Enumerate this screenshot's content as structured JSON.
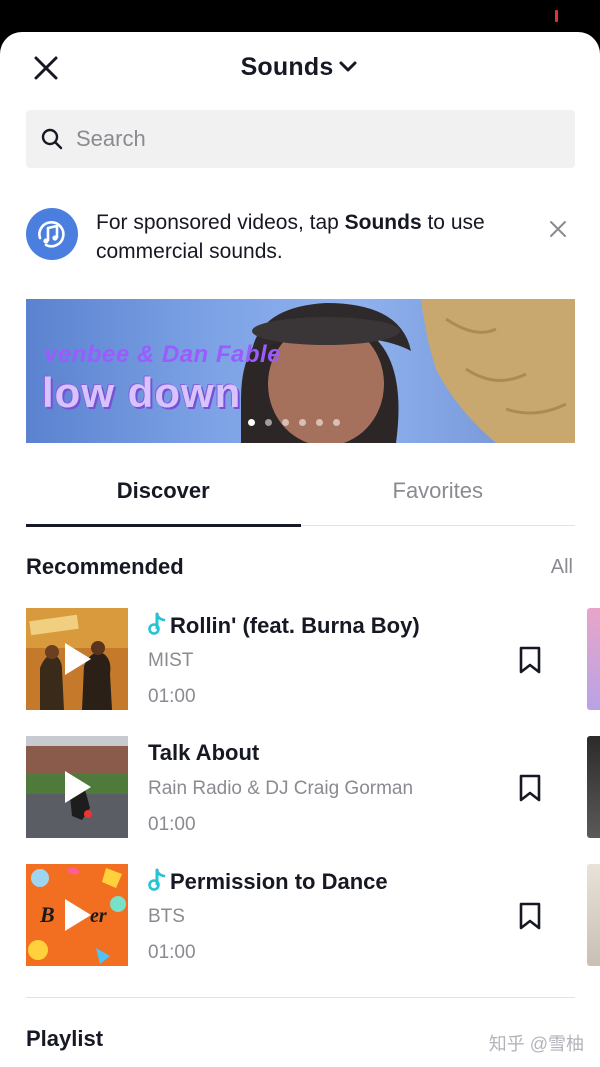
{
  "header": {
    "title": "Sounds"
  },
  "search": {
    "placeholder": "Search"
  },
  "notice": {
    "text_before": "For sponsored videos, tap ",
    "text_bold": "Sounds",
    "text_after": " to use commercial sounds."
  },
  "banner": {
    "artist": "venbee & Dan Fable",
    "song": "low down",
    "slide_count": 6,
    "active_slide": 1
  },
  "tabs": [
    {
      "label": "Discover",
      "active": true
    },
    {
      "label": "Favorites",
      "active": false
    }
  ],
  "recommended": {
    "title": "Recommended",
    "all_label": "All",
    "tracks": [
      {
        "title": "Rollin' (feat. Burna Boy)",
        "artist": "MIST",
        "duration": "01:00",
        "has_note": true
      },
      {
        "title": "Talk About",
        "artist": "Rain Radio & DJ Craig Gorman",
        "duration": "01:00",
        "has_note": false
      },
      {
        "title": "Permission to Dance",
        "artist": "BTS",
        "duration": "01:00",
        "has_note": true
      }
    ]
  },
  "playlist": {
    "title": "Playlist"
  },
  "watermark": "知乎 @雪柚",
  "colors": {
    "accent_note": "#25c3d6",
    "notice_icon": "#4a7fe0",
    "text_primary": "#161823",
    "text_secondary": "#8a8b91"
  }
}
